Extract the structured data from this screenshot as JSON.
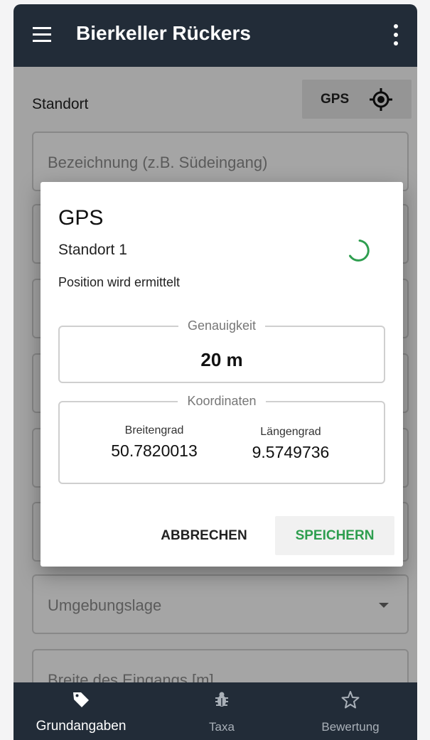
{
  "app_bar": {
    "title": "Bierkeller Rückers"
  },
  "form": {
    "standort_label": "Standort",
    "gps_button_label": "GPS",
    "fields": [
      {
        "placeholder": "Bezeichnung (z.B. Südeingang)"
      },
      {
        "placeholder": ""
      },
      {
        "placeholder": ""
      },
      {
        "placeholder": ""
      },
      {
        "placeholder": ""
      },
      {
        "placeholder": ""
      },
      {
        "placeholder": "Umgebungslage"
      },
      {
        "placeholder": "Breite des Eingangs [m]"
      }
    ]
  },
  "dialog": {
    "title": "GPS",
    "subtitle": "Standort 1",
    "status": "Position wird ermittelt",
    "accuracy": {
      "legend": "Genauigkeit",
      "value": "20 m"
    },
    "coordinates": {
      "legend": "Koordinaten",
      "lat_label": "Breitengrad",
      "lat_value": "50.7820013",
      "lon_label": "Längengrad",
      "lon_value": "9.5749736"
    },
    "cancel_label": "ABBRECHEN",
    "save_label": "SPEICHERN"
  },
  "bottom_nav": {
    "items": [
      {
        "label": "Grundangaben",
        "icon": "tag-icon",
        "active": true
      },
      {
        "label": "Taxa",
        "icon": "bug-icon",
        "active": false
      },
      {
        "label": "Bewertung",
        "icon": "star-icon",
        "active": false
      }
    ]
  },
  "colors": {
    "app_bar": "#222c38",
    "accent_green": "#2e9e4f"
  }
}
